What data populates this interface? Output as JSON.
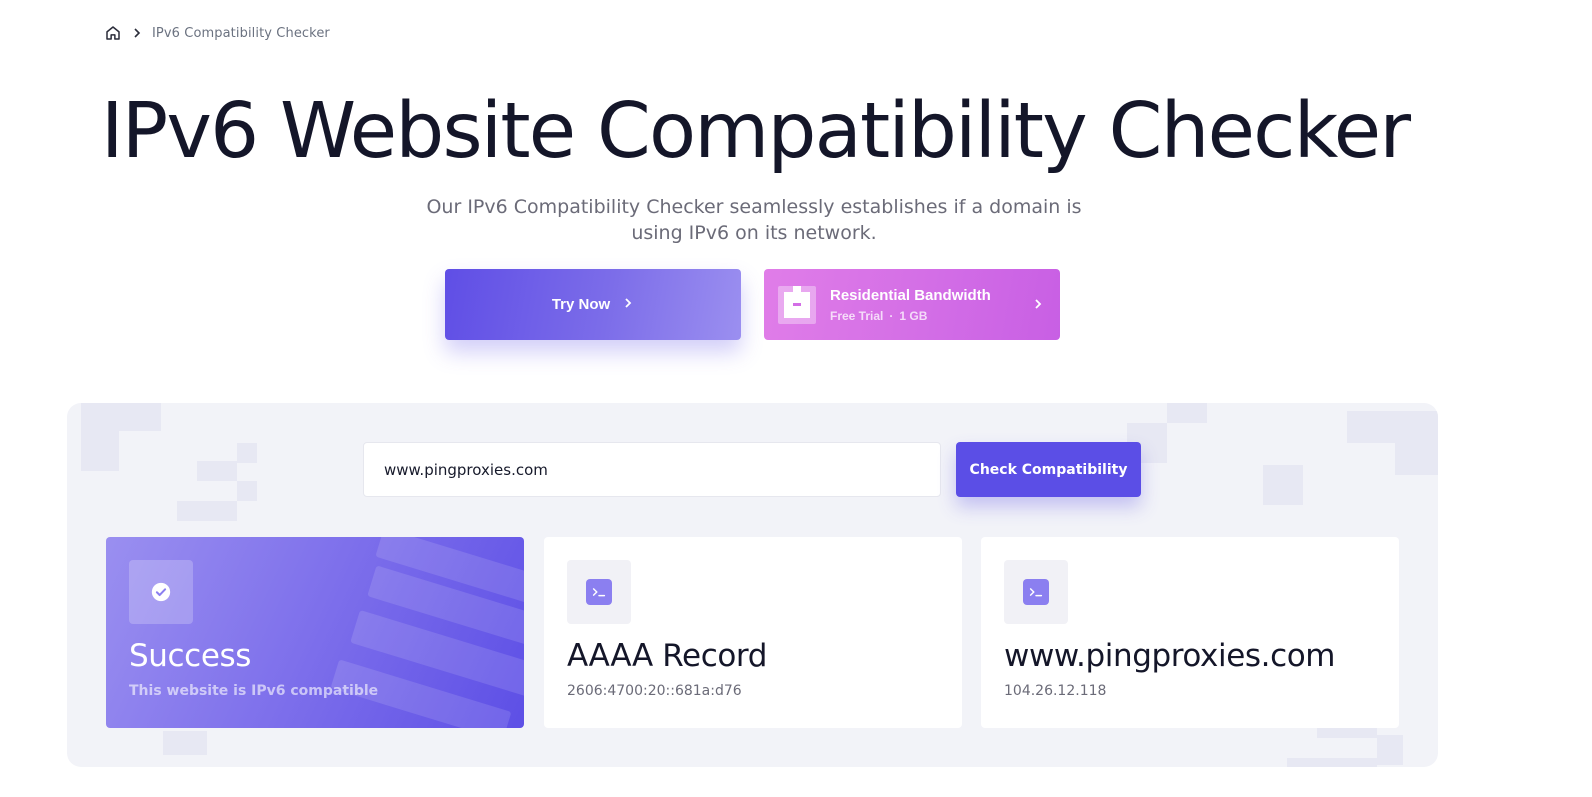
{
  "breadcrumb": {
    "current": "IPv6 Compatibility Checker"
  },
  "hero": {
    "title": "IPv6 Website Compatibility Checker",
    "subtitle": "Our IPv6 Compatibility Checker seamlessly establishes if a domain is using IPv6 on its network."
  },
  "cta": {
    "try_now": "Try Now",
    "residential": {
      "title": "Residential Bandwidth",
      "trial": "Free Trial",
      "separator": "·",
      "amount": "1 GB"
    }
  },
  "checker": {
    "input_value": "www.pingproxies.com",
    "button_label": "Check Compatibility"
  },
  "results": [
    {
      "icon": "check-circle-icon",
      "title": "Success",
      "subtitle": "This website is IPv6 compatible"
    },
    {
      "icon": "terminal-icon",
      "title": "AAAA Record",
      "subtitle": "2606:4700:20::681a:d76"
    },
    {
      "icon": "terminal-icon",
      "title": "www.pingproxies.com",
      "subtitle": "104.26.12.118"
    }
  ],
  "colors": {
    "accent": "#5b4ee6",
    "pink": "#d36ee6",
    "panel": "#f2f3f8",
    "title": "#141629"
  }
}
